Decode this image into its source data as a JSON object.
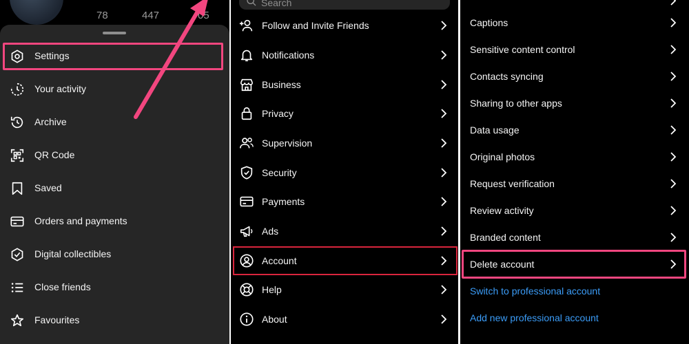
{
  "profile": {
    "posts": "78",
    "followers": "447",
    "following": "05"
  },
  "menu": [
    {
      "id": "settings",
      "label": "Settings",
      "icon": "settings-gear-icon"
    },
    {
      "id": "your-activity",
      "label": "Your activity",
      "icon": "activity-clock-icon"
    },
    {
      "id": "archive",
      "label": "Archive",
      "icon": "archive-clock-icon"
    },
    {
      "id": "qr-code",
      "label": "QR Code",
      "icon": "qr-code-icon"
    },
    {
      "id": "saved",
      "label": "Saved",
      "icon": "bookmark-icon"
    },
    {
      "id": "orders",
      "label": "Orders and payments",
      "icon": "card-icon"
    },
    {
      "id": "collectibles",
      "label": "Digital collectibles",
      "icon": "badge-check-icon"
    },
    {
      "id": "close-friends",
      "label": "Close friends",
      "icon": "list-icon"
    },
    {
      "id": "favourites",
      "label": "Favourites",
      "icon": "star-icon"
    }
  ],
  "settings": {
    "search_placeholder": "Search",
    "items": [
      {
        "id": "follow",
        "label": "Follow and Invite Friends",
        "icon": "add-person-icon"
      },
      {
        "id": "notifications",
        "label": "Notifications",
        "icon": "bell-icon"
      },
      {
        "id": "business",
        "label": "Business",
        "icon": "store-icon"
      },
      {
        "id": "privacy",
        "label": "Privacy",
        "icon": "lock-icon"
      },
      {
        "id": "supervision",
        "label": "Supervision",
        "icon": "people-icon"
      },
      {
        "id": "security",
        "label": "Security",
        "icon": "shield-icon"
      },
      {
        "id": "payments",
        "label": "Payments",
        "icon": "card-icon"
      },
      {
        "id": "ads",
        "label": "Ads",
        "icon": "megaphone-icon"
      },
      {
        "id": "account",
        "label": "Account",
        "icon": "account-circle-icon"
      },
      {
        "id": "help",
        "label": "Help",
        "icon": "lifebuoy-icon"
      },
      {
        "id": "about",
        "label": "About",
        "icon": "info-icon"
      }
    ]
  },
  "account": {
    "items": [
      {
        "id": "captions",
        "label": "Captions"
      },
      {
        "id": "sensitive",
        "label": "Sensitive content control"
      },
      {
        "id": "contacts",
        "label": "Contacts syncing"
      },
      {
        "id": "sharing",
        "label": "Sharing to other apps"
      },
      {
        "id": "data-usage",
        "label": "Data usage"
      },
      {
        "id": "original-photos",
        "label": "Original photos"
      },
      {
        "id": "verification",
        "label": "Request verification"
      },
      {
        "id": "review-activity",
        "label": "Review activity"
      },
      {
        "id": "branded",
        "label": "Branded content"
      },
      {
        "id": "delete",
        "label": "Delete account"
      }
    ],
    "links": [
      {
        "id": "switch-pro",
        "label": "Switch to professional account"
      },
      {
        "id": "add-pro",
        "label": "Add new professional account"
      }
    ]
  },
  "colors": {
    "highlight": "#f2467f",
    "account_highlight": "#d9253d",
    "link": "#3b9cf7",
    "sheet": "#262626"
  }
}
